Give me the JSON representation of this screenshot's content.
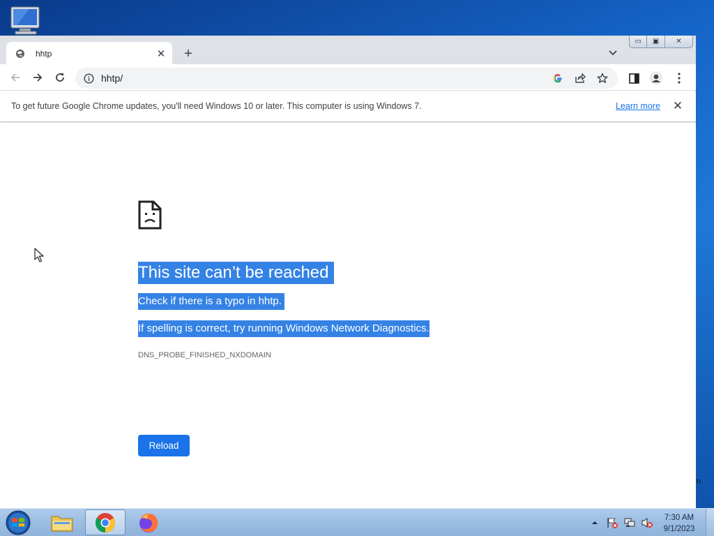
{
  "desktop": {
    "icon": "computer-icon"
  },
  "tab": {
    "title": "hhtp",
    "favicon": "globe-icon",
    "close_glyph": "✕"
  },
  "tabstrip": {
    "new_tab_glyph": "+",
    "tab_search_icon": "chevron-down-icon"
  },
  "window_controls": {
    "minimize": "▭",
    "maximize": "▣",
    "close": "✕"
  },
  "toolbar": {
    "back_icon": "arrow-left-icon",
    "forward_icon": "arrow-right-icon",
    "reload_icon": "reload-icon",
    "url": "hhtp/",
    "site_info_icon": "info-icon",
    "google_icon": "google-icon",
    "share_icon": "share-icon",
    "bookmark_icon": "star-icon",
    "side_panel_icon": "side-panel-icon",
    "profile_icon": "profile-icon",
    "menu_icon": "kebab-menu-icon"
  },
  "infobar": {
    "message": "To get future Google Chrome updates, you'll need Windows 10 or later. This computer is using Windows 7.",
    "link": "Learn more",
    "close_glyph": "✕"
  },
  "error": {
    "icon": "sad-page-icon",
    "title": "This site can’t be reached",
    "line1": "Check if there is a typo in hhtp.",
    "line2": "If spelling is correct, try running Windows Network Diagnostics.",
    "code": "DNS_PROBE_FINISHED_NXDOMAIN",
    "reload_label": "Reload",
    "selection_color": "#3582e5",
    "button_color": "#1a73e8"
  },
  "taskbar": {
    "apps": [
      {
        "name": "windows-explorer",
        "icon": "folder-icon"
      },
      {
        "name": "google-chrome",
        "icon": "chrome-icon",
        "active": true
      },
      {
        "name": "firefox",
        "icon": "firefox-icon"
      }
    ],
    "tray_icons": [
      "show-hidden-icons-icon",
      "action-center-flag-icon",
      "network-icon",
      "volume-muted-icon"
    ],
    "time": "7:30 AM",
    "date": "9/1/2023"
  }
}
